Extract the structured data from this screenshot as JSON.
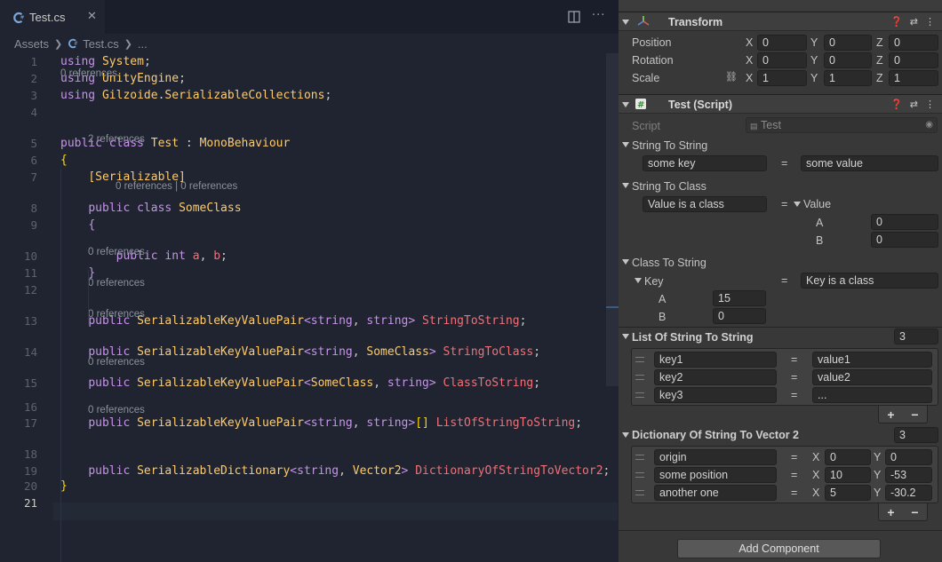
{
  "editor": {
    "tab_label": "Test.cs",
    "breadcrumb": {
      "root": "Assets",
      "file": "Test.cs",
      "more": "..."
    },
    "lines": [
      {
        "n": "1",
        "segments": [
          [
            "kw",
            "using"
          ],
          [
            "pu",
            " "
          ],
          [
            "ty",
            "System"
          ],
          [
            "pu",
            ";"
          ]
        ]
      },
      {
        "n": "2",
        "segments": [
          [
            "kw",
            "using"
          ],
          [
            "pu",
            " "
          ],
          [
            "ty",
            "UnityEngine"
          ],
          [
            "pu",
            ";"
          ]
        ]
      },
      {
        "n": "3",
        "segments": [
          [
            "kw",
            "using"
          ],
          [
            "pu",
            " "
          ],
          [
            "ty",
            "Gilzoide"
          ],
          [
            "pu",
            "."
          ],
          [
            "ty",
            "SerializableCollections"
          ],
          [
            "pu",
            ";"
          ]
        ]
      },
      {
        "n": "4",
        "segments": []
      },
      {
        "n": "5",
        "segments": [
          [
            "kw",
            "public"
          ],
          [
            "pu",
            " "
          ],
          [
            "kw",
            "class"
          ],
          [
            "pu",
            " "
          ],
          [
            "ty",
            "Test"
          ],
          [
            "pu",
            " : "
          ],
          [
            "ty",
            "MonoBehaviour"
          ]
        ]
      },
      {
        "n": "6",
        "segments": [
          [
            "br",
            "{"
          ]
        ]
      },
      {
        "n": "7",
        "segments": [
          [
            "pu",
            "    "
          ],
          [
            "at",
            "[Serializable]"
          ]
        ]
      },
      {
        "n": "8",
        "segments": [
          [
            "pu",
            "    "
          ],
          [
            "kw",
            "public"
          ],
          [
            "pu",
            " "
          ],
          [
            "kw",
            "class"
          ],
          [
            "pu",
            " "
          ],
          [
            "ty",
            "SomeClass"
          ]
        ]
      },
      {
        "n": "9",
        "segments": [
          [
            "pu",
            "    "
          ],
          [
            "kw",
            "{"
          ]
        ]
      },
      {
        "n": "10",
        "segments": [
          [
            "pu",
            "        "
          ],
          [
            "kw",
            "public"
          ],
          [
            "pu",
            " "
          ],
          [
            "kw",
            "int"
          ],
          [
            "pu",
            " "
          ],
          [
            "fld",
            "a"
          ],
          [
            "pu",
            ", "
          ],
          [
            "fld",
            "b"
          ],
          [
            "pu",
            ";"
          ]
        ]
      },
      {
        "n": "11",
        "segments": [
          [
            "pu",
            "    "
          ],
          [
            "kw",
            "}"
          ]
        ]
      },
      {
        "n": "12",
        "segments": []
      },
      {
        "n": "13",
        "segments": [
          [
            "pu",
            "    "
          ],
          [
            "kw",
            "public"
          ],
          [
            "pu",
            " "
          ],
          [
            "ty",
            "SerializableKeyValuePair"
          ],
          [
            "kw",
            "<"
          ],
          [
            "kw",
            "string"
          ],
          [
            "pu",
            ", "
          ],
          [
            "kw",
            "string"
          ],
          [
            "kw",
            ">"
          ],
          [
            "pu",
            " "
          ],
          [
            "fld",
            "StringToString"
          ],
          [
            "pu",
            ";"
          ]
        ]
      },
      {
        "n": "14",
        "segments": [
          [
            "pu",
            "    "
          ],
          [
            "kw",
            "public"
          ],
          [
            "pu",
            " "
          ],
          [
            "ty",
            "SerializableKeyValuePair"
          ],
          [
            "kw",
            "<"
          ],
          [
            "kw",
            "string"
          ],
          [
            "pu",
            ", "
          ],
          [
            "ty",
            "SomeClass"
          ],
          [
            "kw",
            ">"
          ],
          [
            "pu",
            " "
          ],
          [
            "fld",
            "StringToClass"
          ],
          [
            "pu",
            ";"
          ]
        ]
      },
      {
        "n": "15",
        "segments": [
          [
            "pu",
            "    "
          ],
          [
            "kw",
            "public"
          ],
          [
            "pu",
            " "
          ],
          [
            "ty",
            "SerializableKeyValuePair"
          ],
          [
            "kw",
            "<"
          ],
          [
            "ty",
            "SomeClass"
          ],
          [
            "pu",
            ", "
          ],
          [
            "kw",
            "string"
          ],
          [
            "kw",
            ">"
          ],
          [
            "pu",
            " "
          ],
          [
            "fld",
            "ClassToString"
          ],
          [
            "pu",
            ";"
          ]
        ]
      },
      {
        "n": "16",
        "segments": []
      },
      {
        "n": "17",
        "segments": [
          [
            "pu",
            "    "
          ],
          [
            "kw",
            "public"
          ],
          [
            "pu",
            " "
          ],
          [
            "ty",
            "SerializableKeyValuePair"
          ],
          [
            "kw",
            "<"
          ],
          [
            "kw",
            "string"
          ],
          [
            "pu",
            ", "
          ],
          [
            "kw",
            "string"
          ],
          [
            "kw",
            ">"
          ],
          [
            "br",
            "[]"
          ],
          [
            "pu",
            " "
          ],
          [
            "fld",
            "ListOfStringToString"
          ],
          [
            "pu",
            ";"
          ]
        ]
      },
      {
        "n": "18",
        "segments": []
      },
      {
        "n": "19",
        "segments": [
          [
            "pu",
            "    "
          ],
          [
            "kw",
            "public"
          ],
          [
            "pu",
            " "
          ],
          [
            "ty",
            "SerializableDictionary"
          ],
          [
            "kw",
            "<"
          ],
          [
            "kw",
            "string"
          ],
          [
            "pu",
            ", "
          ],
          [
            "ty",
            "Vector2"
          ],
          [
            "kw",
            ">"
          ],
          [
            "pu",
            " "
          ],
          [
            "fld",
            "DictionaryOfStringToVector2"
          ],
          [
            "pu",
            ";"
          ]
        ]
      },
      {
        "n": "20",
        "segments": [
          [
            "br",
            "}"
          ]
        ]
      },
      {
        "n": "21",
        "segments": []
      }
    ],
    "codelens": {
      "l5": "0 references",
      "l8": "2 references",
      "l10": "0 references | 0 references",
      "l13": "0 references",
      "l14": "0 references",
      "l15": "0 references",
      "l17": "0 references",
      "l19": "0 references"
    }
  },
  "inspector": {
    "transform": {
      "title": "Transform",
      "rows": [
        {
          "label": "Position",
          "x": "0",
          "y": "0",
          "z": "0"
        },
        {
          "label": "Rotation",
          "x": "0",
          "y": "0",
          "z": "0"
        },
        {
          "label": "Scale",
          "x": "1",
          "y": "1",
          "z": "1"
        }
      ],
      "axis": {
        "x": "X",
        "y": "Y",
        "z": "Z"
      }
    },
    "script_comp": {
      "title": "Test (Script)",
      "script_label": "Script",
      "script_value": "Test",
      "eq": "=",
      "string_to_string": {
        "label": "String To String",
        "key": "some key",
        "value": "some value"
      },
      "string_to_class": {
        "label": "String To Class",
        "key": "Value is a class",
        "value_label": "Value",
        "a_label": "A",
        "a": "0",
        "b_label": "B",
        "b": "0"
      },
      "class_to_string": {
        "label": "Class To String",
        "key_label": "Key",
        "a_label": "A",
        "a": "15",
        "b_label": "B",
        "b": "0",
        "value": "Key is a class"
      },
      "list_of_string": {
        "label": "List Of String To String",
        "count": "3",
        "items": [
          {
            "key": "key1",
            "value": "value1"
          },
          {
            "key": "key2",
            "value": "value2"
          },
          {
            "key": "key3",
            "value": "..."
          }
        ],
        "plus": "+",
        "minus": "−"
      },
      "dictionary": {
        "label": "Dictionary Of String To Vector 2",
        "count": "3",
        "items": [
          {
            "key": "origin",
            "x": "0",
            "y": "0"
          },
          {
            "key": "some position",
            "x": "10",
            "y": "-53"
          },
          {
            "key": "another one",
            "x": "5",
            "y": "-30.2"
          }
        ],
        "plus": "+",
        "minus": "−"
      }
    },
    "add_component": "Add Component"
  },
  "colors": {
    "keyword": "#c792ea",
    "type": "#ffcb6b",
    "field": "#f07178",
    "editor_bg": "#1f2430",
    "inspector_bg": "#383838"
  }
}
